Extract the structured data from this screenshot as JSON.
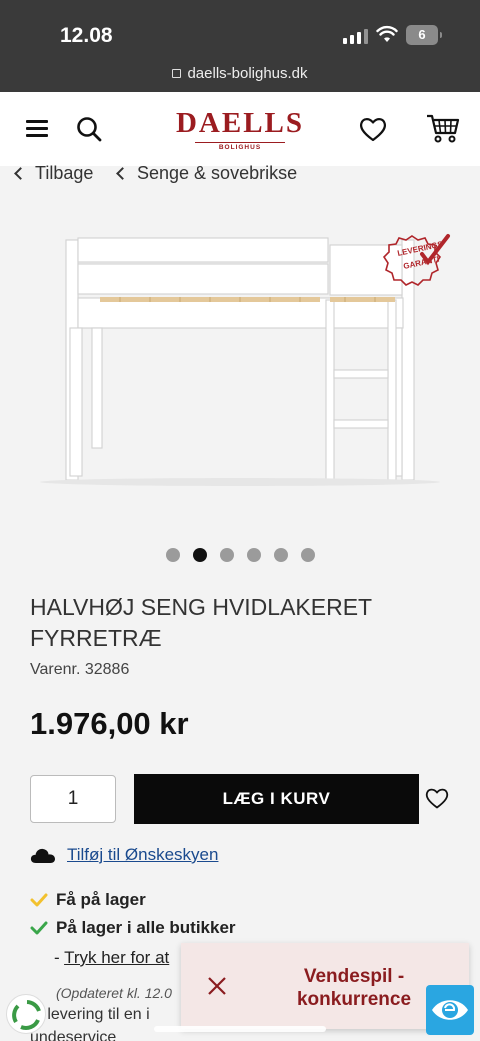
{
  "status_bar": {
    "time": "12.08",
    "battery": "6",
    "url": "daells-bolighus.dk"
  },
  "header": {
    "logo": {
      "brand": "DAELLS",
      "sub": "BOLIGHUS"
    },
    "icons": [
      "menu-icon",
      "search-icon",
      "heart-icon",
      "cart-icon"
    ]
  },
  "breadcrumb": {
    "back": "Tilbage",
    "category": "Senge & sovebrikse"
  },
  "product": {
    "badge_line1": "LEVERINGS",
    "badge_line2": "GARANTI",
    "image_count": 6,
    "active_image": 2,
    "title": "HALVHØJ SENG HVIDLAKERET FYRRETRÆ",
    "sku": "Varenr. 32886",
    "price": "1.976,00 kr",
    "quantity": "1",
    "add_to_cart": "LÆG I KURV",
    "wishlist_link": "Tilføj til Ønskeskyen",
    "stock_1": "Få på lager",
    "stock_2": "På lager i alle butikker",
    "tryk_prefix": "- ",
    "tryk_link": "Tryk her for at",
    "updated": "(Opdateret kl. 12.0",
    "delivery": "d levering til en i",
    "service": "undeservice"
  },
  "popup": {
    "message": "Vendespil - konkurrence"
  },
  "colors": {
    "brand": "#9b1c20",
    "link": "#1a4a8e",
    "stock_yellow": "#f2c12e",
    "stock_green": "#3aa64a",
    "popup_bg": "#f4e7e6"
  }
}
